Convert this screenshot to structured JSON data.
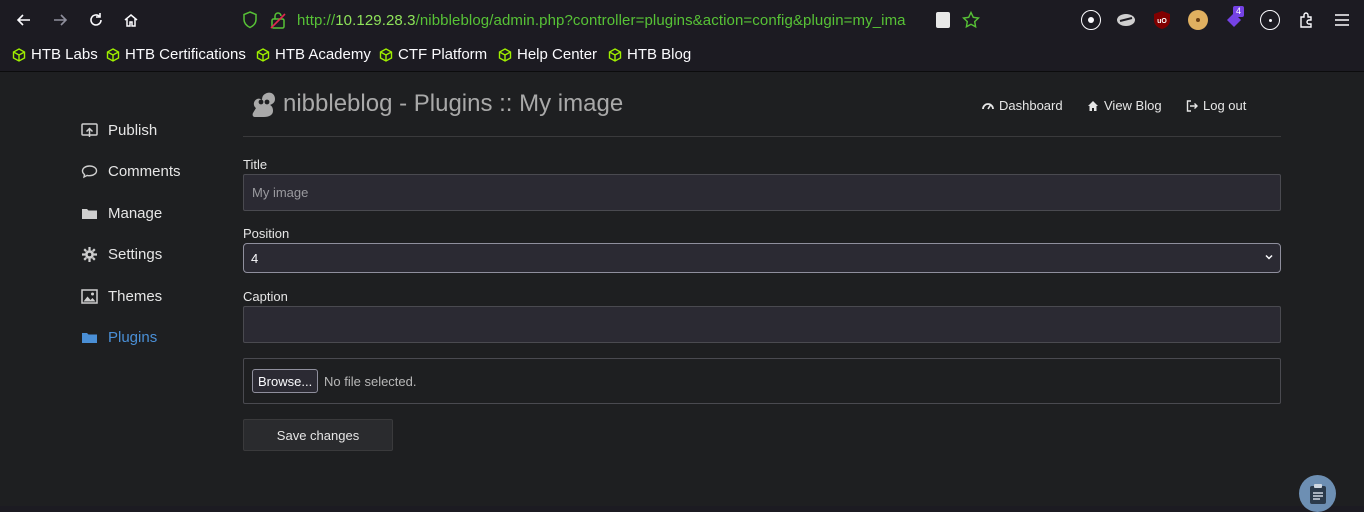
{
  "browser": {
    "url_prefix": "http://",
    "url_host": "10.129.28.3",
    "url_path": "/nibbleblog/admin.php?controller=plugins&action=config&plugin=my_ima",
    "extension_badge": "4"
  },
  "bookmarks": [
    {
      "label": "HTB Labs"
    },
    {
      "label": "HTB Certifications"
    },
    {
      "label": "HTB Academy"
    },
    {
      "label": "CTF Platform"
    },
    {
      "label": "Help Center"
    },
    {
      "label": "HTB Blog"
    }
  ],
  "sidebar": {
    "items": [
      {
        "label": "Publish",
        "icon": "publish-icon"
      },
      {
        "label": "Comments",
        "icon": "comment-icon"
      },
      {
        "label": "Manage",
        "icon": "folder-icon"
      },
      {
        "label": "Settings",
        "icon": "gear-icon"
      },
      {
        "label": "Themes",
        "icon": "image-icon"
      },
      {
        "label": "Plugins",
        "icon": "folder-icon",
        "active": true
      }
    ]
  },
  "header": {
    "title": "nibbleblog - Plugins :: My image",
    "nav": [
      {
        "label": "Dashboard",
        "icon": "dashboard-icon"
      },
      {
        "label": "View Blog",
        "icon": "home-icon"
      },
      {
        "label": "Log out",
        "icon": "logout-icon"
      }
    ]
  },
  "form": {
    "title_label": "Title",
    "title_placeholder": "My image",
    "position_label": "Position",
    "position_value": "4",
    "caption_label": "Caption",
    "caption_value": "",
    "browse_label": "Browse...",
    "no_file_text": "No file selected.",
    "save_label": "Save changes"
  },
  "colors": {
    "accent": "#4a8fd6",
    "url_green": "#57c236",
    "page_bg": "#1e1f21"
  }
}
